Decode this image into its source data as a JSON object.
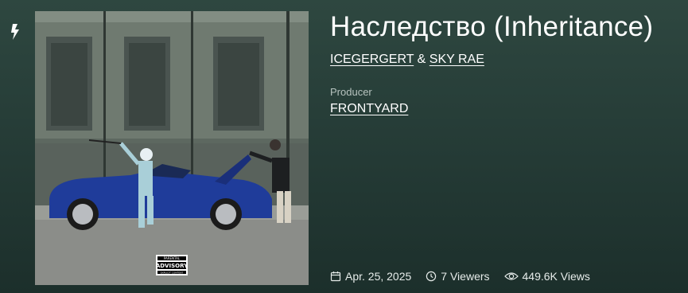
{
  "song": {
    "title": "Наследство (Inheritance)",
    "artists": [
      "ICEGERGERT",
      "SKY RAE"
    ],
    "artist_separator": "&",
    "producer_label": "Producer",
    "producer": "FRONTYARD"
  },
  "meta": {
    "release_date": "Apr. 25, 2025",
    "viewers": "7 Viewers",
    "views": "449.6K Views"
  },
  "cover_art": {
    "advisory_line1": "PARENTAL",
    "advisory_line2": "ADVISORY",
    "advisory_line3": "EXPLICIT CONTENT"
  },
  "colors": {
    "background_top": "#2e4740",
    "background_bottom": "#1c2f2b",
    "car": "#1f3c9a"
  }
}
